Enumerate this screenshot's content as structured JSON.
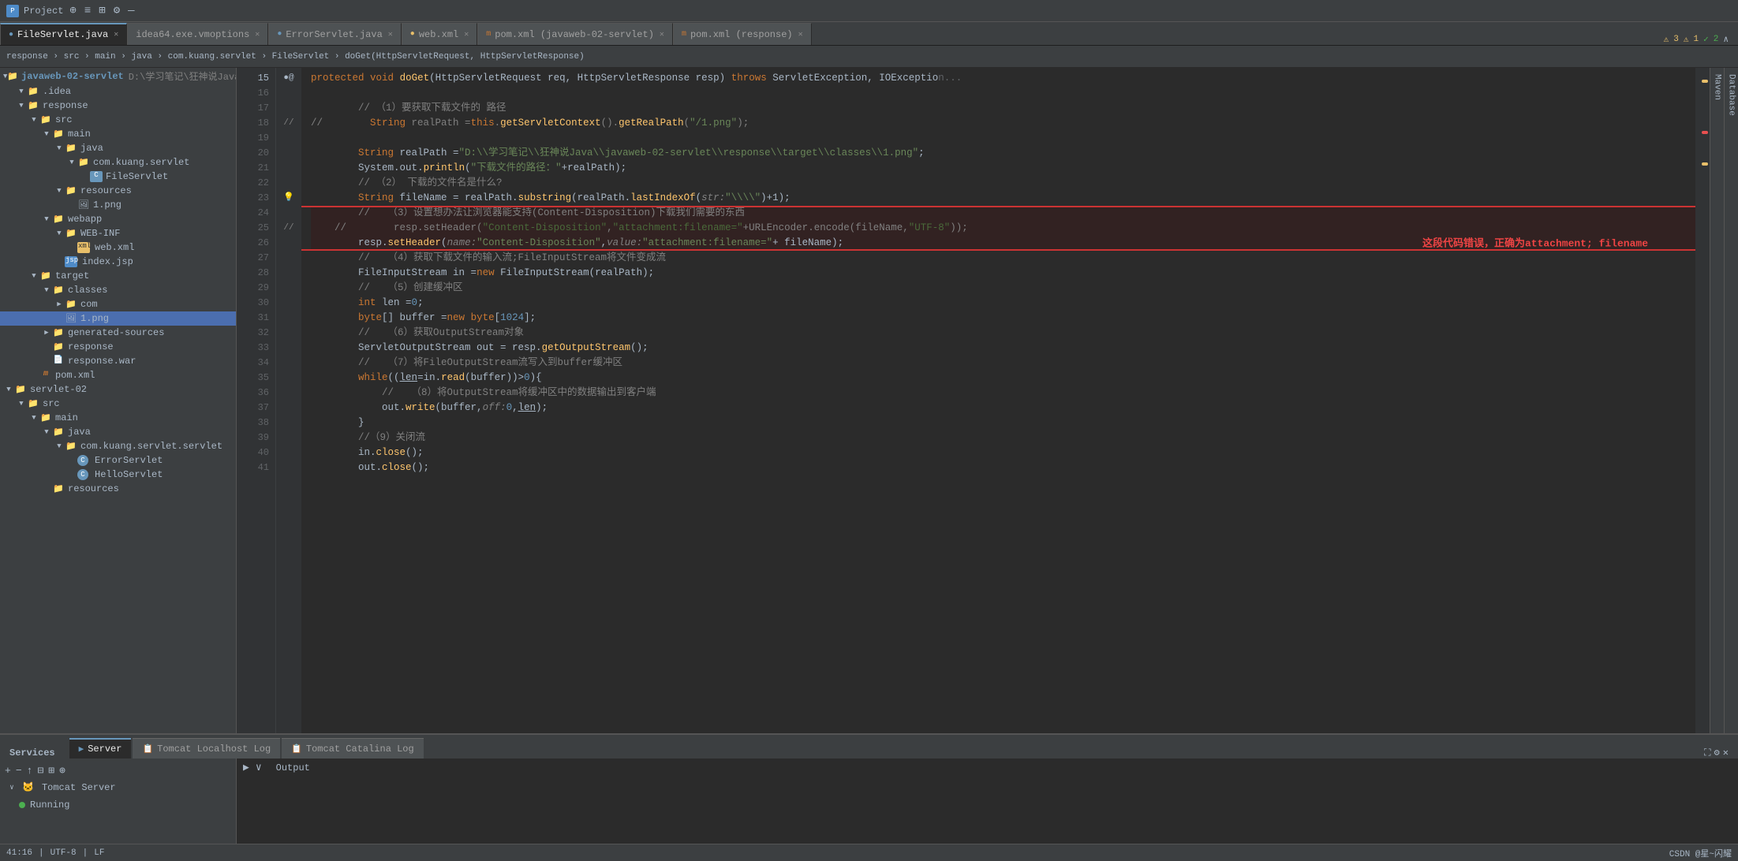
{
  "topbar": {
    "project_label": "Project",
    "icons": [
      "⊕",
      "≡",
      "⊞",
      "⚙",
      "—"
    ]
  },
  "tabs": [
    {
      "label": "FileServlet.java",
      "type": "java",
      "active": true
    },
    {
      "label": "idea64.exe.vmoptions",
      "type": "config",
      "active": false
    },
    {
      "label": "ErrorServlet.java",
      "type": "java",
      "active": false
    },
    {
      "label": "web.xml",
      "type": "xml",
      "active": false
    },
    {
      "label": "pom.xml (javaweb-02-servlet)",
      "type": "pom",
      "active": false
    },
    {
      "label": "pom.xml (response)",
      "type": "pom",
      "active": false
    }
  ],
  "breadcrumb": "response › src › main › java › com.kuang.servlet › FileServlet › doGet(HttpServletRequest, HttpServletResponse)",
  "sidebar": {
    "items": [
      {
        "indent": 0,
        "arrow": "▼",
        "icon": "📁",
        "label": "javaweb-02-servlet",
        "type": "folder",
        "path": "D:\\学习笔记\\狂神说Java\\javaweb-c..."
      },
      {
        "indent": 1,
        "arrow": "▼",
        "icon": "📁",
        "label": ".idea",
        "type": "folder"
      },
      {
        "indent": 1,
        "arrow": "▼",
        "icon": "📁",
        "label": "response",
        "type": "folder"
      },
      {
        "indent": 2,
        "arrow": "▼",
        "icon": "📁",
        "label": "src",
        "type": "folder"
      },
      {
        "indent": 3,
        "arrow": "▼",
        "icon": "📁",
        "label": "main",
        "type": "folder"
      },
      {
        "indent": 4,
        "arrow": "▼",
        "icon": "📁",
        "label": "java",
        "type": "folder"
      },
      {
        "indent": 5,
        "arrow": "▼",
        "icon": "📁",
        "label": "com.kuang.servlet",
        "type": "folder"
      },
      {
        "indent": 6,
        "arrow": " ",
        "icon": "C",
        "label": "FileServlet",
        "type": "java"
      },
      {
        "indent": 4,
        "arrow": "▼",
        "icon": "📁",
        "label": "resources",
        "type": "folder"
      },
      {
        "indent": 5,
        "arrow": " ",
        "icon": "🖼",
        "label": "1.png",
        "type": "png"
      },
      {
        "indent": 3,
        "arrow": "▼",
        "icon": "📁",
        "label": "webapp",
        "type": "folder"
      },
      {
        "indent": 4,
        "arrow": "▼",
        "icon": "📁",
        "label": "WEB-INF",
        "type": "folder"
      },
      {
        "indent": 5,
        "arrow": " ",
        "icon": "xml",
        "label": "web.xml",
        "type": "xml"
      },
      {
        "indent": 4,
        "arrow": " ",
        "icon": "jsp",
        "label": "index.jsp",
        "type": "jsp"
      },
      {
        "indent": 2,
        "arrow": "▼",
        "icon": "📁",
        "label": "target",
        "type": "folder"
      },
      {
        "indent": 3,
        "arrow": "▼",
        "icon": "📁",
        "label": "classes",
        "type": "folder"
      },
      {
        "indent": 4,
        "arrow": "▶",
        "icon": "📁",
        "label": "com",
        "type": "folder"
      },
      {
        "indent": 4,
        "arrow": " ",
        "icon": "🖼",
        "label": "1.png",
        "type": "png",
        "selected": true
      },
      {
        "indent": 3,
        "arrow": "▶",
        "icon": "📁",
        "label": "generated-sources",
        "type": "folder"
      },
      {
        "indent": 3,
        "arrow": " ",
        "icon": "📁",
        "label": "response",
        "type": "folder"
      },
      {
        "indent": 3,
        "arrow": " ",
        "icon": "📄",
        "label": "response.war",
        "type": "war"
      },
      {
        "indent": 2,
        "arrow": " ",
        "icon": "m",
        "label": "pom.xml",
        "type": "pom"
      },
      {
        "indent": 0,
        "arrow": "▼",
        "icon": "📁",
        "label": "servlet-02",
        "type": "folder"
      },
      {
        "indent": 1,
        "arrow": "▼",
        "icon": "📁",
        "label": "src",
        "type": "folder"
      },
      {
        "indent": 2,
        "arrow": "▼",
        "icon": "📁",
        "label": "main",
        "type": "folder"
      },
      {
        "indent": 3,
        "arrow": "▼",
        "icon": "📁",
        "label": "java",
        "type": "folder"
      },
      {
        "indent": 4,
        "arrow": "▼",
        "icon": "📁",
        "label": "com.kuang.servlet.servlet",
        "type": "folder"
      },
      {
        "indent": 5,
        "arrow": " ",
        "icon": "C",
        "label": "ErrorServlet",
        "type": "java"
      },
      {
        "indent": 5,
        "arrow": " ",
        "icon": "C",
        "label": "HelloServlet",
        "type": "java"
      },
      {
        "indent": 3,
        "arrow": " ",
        "icon": "📁",
        "label": "resources",
        "type": "folder"
      }
    ]
  },
  "code": {
    "lines": [
      {
        "num": 15,
        "gutter": "●@",
        "content": "    protected void doGet(HttpServletRequest req, HttpServletResponse resp) throws ServletException, IOExceptio",
        "type": "method-sig"
      },
      {
        "num": 16,
        "gutter": "",
        "content": ""
      },
      {
        "num": 17,
        "gutter": "",
        "content": "        // （1）要获取下载文件的 路径"
      },
      {
        "num": 18,
        "gutter": "//",
        "content": "        String realPath = this.getServletContext().getRealPath(\"/1.png\");"
      },
      {
        "num": 19,
        "gutter": "",
        "content": ""
      },
      {
        "num": 20,
        "gutter": "",
        "content": "        String realPath = \"D:\\\\学习笔记\\\\狂神说Java\\\\javaweb-02-servlet\\\\response\\\\target\\\\classes\\\\1.png\";"
      },
      {
        "num": 21,
        "gutter": "",
        "content": "        System.out.println(\"下载文件的路径：\"+realPath);"
      },
      {
        "num": 22,
        "gutter": "",
        "content": "        // （2） 下载的文件名是什么?"
      },
      {
        "num": 23,
        "gutter": "💡",
        "content": "        String fileName = realPath.substring(realPath.lastIndexOf( str: \"\\\\\")+1);"
      },
      {
        "num": 24,
        "gutter": "",
        "content": "        //   （3）设置想办法让浏览器能支持(Content-Disposition)下载我们需要的东西",
        "highlighted": true
      },
      {
        "num": 25,
        "gutter": "//",
        "content": "          resp.setHeader(\"Content-Disposition\",\"attachment:filename=\"+ URLEncoder.encode(fileName,\"UTF-8\"));",
        "highlighted": true
      },
      {
        "num": 26,
        "gutter": "",
        "content": "        resp.setHeader( name: \"Content-Disposition\", value: \"attachment:filename=\"+ fileName);",
        "highlighted": true
      },
      {
        "num": 27,
        "gutter": "",
        "content": "        //   （4）获取下载文件的输入流;FileInputStream将文件变成流"
      },
      {
        "num": 28,
        "gutter": "",
        "content": "        FileInputStream in = new FileInputStream(realPath);"
      },
      {
        "num": 29,
        "gutter": "",
        "content": "        //   （5）创建缓冲区"
      },
      {
        "num": 30,
        "gutter": "",
        "content": "        int len = 0;"
      },
      {
        "num": 31,
        "gutter": "",
        "content": "        byte[] buffer = new byte[1024];"
      },
      {
        "num": 32,
        "gutter": "",
        "content": "        //   （6）获取OutputStream对象"
      },
      {
        "num": 33,
        "gutter": "",
        "content": "        ServletOutputStream out = resp.getOutputStream();"
      },
      {
        "num": 34,
        "gutter": "",
        "content": "        //   （7）将FileOutputStream流写入到buffer缓冲区"
      },
      {
        "num": 35,
        "gutter": "",
        "content": "        while((len=in.read(buffer))>0){"
      },
      {
        "num": 36,
        "gutter": "",
        "content": "            //   （8）将OutputStream将缓冲区中的数据输出到客户端"
      },
      {
        "num": 37,
        "gutter": "",
        "content": "            out.write(buffer, off: 0,len);"
      },
      {
        "num": 38,
        "gutter": "",
        "content": "        }"
      },
      {
        "num": 39,
        "gutter": "",
        "content": "        //（9）关闭流"
      },
      {
        "num": 40,
        "gutter": "",
        "content": "        in.close();"
      },
      {
        "num": 41,
        "gutter": "",
        "content": "        out.close();"
      }
    ],
    "error_note": "这段代码错误，正确为attachment; filename"
  },
  "status_bar": {
    "right": "CSDN @星~闪耀"
  },
  "bottom": {
    "tabs": [
      {
        "label": "Server",
        "active": true
      },
      {
        "label": "Tomcat Localhost Log",
        "active": false
      },
      {
        "label": "Tomcat Catalina Log",
        "active": false
      }
    ],
    "services_label": "Services",
    "tomcat_label": "Tomcat Server",
    "running_label": "Running",
    "output_label": "Output",
    "console_btn": "▶ ∨"
  },
  "warnings": {
    "count_warn": "3",
    "count_err": "1",
    "count_ok": "2"
  }
}
